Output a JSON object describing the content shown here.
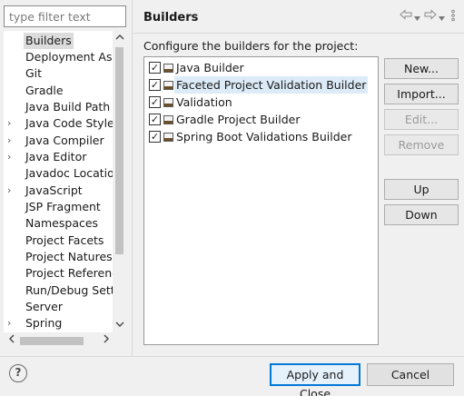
{
  "filter": {
    "placeholder": "type filter text"
  },
  "tree": {
    "items": [
      {
        "label": "Builders",
        "arrow": ""
      },
      {
        "label": "Deployment Assembly",
        "arrow": ""
      },
      {
        "label": "Git",
        "arrow": ""
      },
      {
        "label": "Gradle",
        "arrow": ""
      },
      {
        "label": "Java Build Path",
        "arrow": ""
      },
      {
        "label": "Java Code Style",
        "arrow": "›"
      },
      {
        "label": "Java Compiler",
        "arrow": "›"
      },
      {
        "label": "Java Editor",
        "arrow": "›"
      },
      {
        "label": "Javadoc Location",
        "arrow": ""
      },
      {
        "label": "JavaScript",
        "arrow": "›"
      },
      {
        "label": "JSP Fragment",
        "arrow": ""
      },
      {
        "label": "Namespaces",
        "arrow": ""
      },
      {
        "label": "Project Facets",
        "arrow": ""
      },
      {
        "label": "Project Natures",
        "arrow": ""
      },
      {
        "label": "Project References",
        "arrow": ""
      },
      {
        "label": "Run/Debug Settings",
        "arrow": ""
      },
      {
        "label": "Server",
        "arrow": ""
      },
      {
        "label": "Spring",
        "arrow": "›"
      }
    ],
    "selected_label": "Builders",
    "scroll_icons": {
      "up": "chevron-up-icon",
      "down": "chevron-down-icon",
      "left": "chevron-left-icon",
      "right": "chevron-right-icon"
    }
  },
  "page": {
    "title": "Builders",
    "description": "Configure the builders for the project:",
    "nav_icons": [
      "back-arrow-icon",
      "dropdown-icon",
      "forward-arrow-icon",
      "dropdown-icon",
      "view-menu-icon"
    ]
  },
  "builders": [
    {
      "label": "Java Builder",
      "checked": true
    },
    {
      "label": "Faceted Project Validation Builder",
      "checked": true
    },
    {
      "label": "Validation",
      "checked": true
    },
    {
      "label": "Gradle Project Builder",
      "checked": true
    },
    {
      "label": "Spring Boot Validations Builder",
      "checked": true
    }
  ],
  "selected_builder": "Faceted Project Validation Builder",
  "buttons": {
    "new": "New...",
    "import": "Import...",
    "edit": "Edit...",
    "remove": "Remove",
    "up": "Up",
    "down": "Down"
  },
  "footer": {
    "help": "?",
    "apply_close": "Apply and Close",
    "cancel": "Cancel"
  },
  "colors": {
    "accent": "#0078d7",
    "selection_tree": "#dcdcdc",
    "selection_list": "#dcebf7",
    "disabled_text": "#9a9a9a"
  }
}
